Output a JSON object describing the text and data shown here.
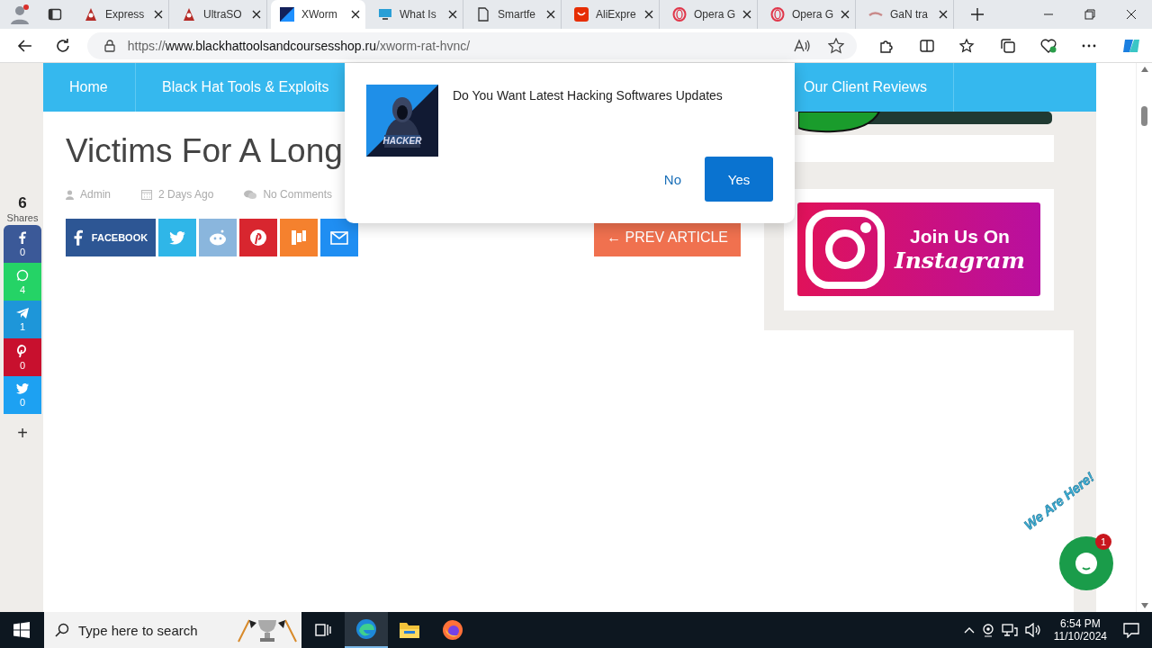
{
  "browser": {
    "tabs": [
      {
        "title": "Express",
        "kind": "hood",
        "selected": false
      },
      {
        "title": "UltraSO",
        "kind": "hood",
        "selected": false
      },
      {
        "title": "XWorm",
        "kind": "dark",
        "selected": true
      },
      {
        "title": "What Is",
        "kind": "monitor",
        "selected": false
      },
      {
        "title": "Smartfe",
        "kind": "page",
        "selected": false
      },
      {
        "title": "AliExpre",
        "kind": "ali",
        "selected": false
      },
      {
        "title": "Opera G",
        "kind": "opera",
        "selected": false
      },
      {
        "title": "Opera G",
        "kind": "opera",
        "selected": false
      },
      {
        "title": "GaN tra",
        "kind": "cable",
        "selected": false
      }
    ],
    "address": {
      "scheme": "https://",
      "host": "www.blackhattoolsandcoursesshop.ru",
      "path": "/xworm-rat-hvnc/"
    }
  },
  "nav": {
    "left": [
      "Home",
      "Black Hat Tools & Exploits"
    ],
    "right": [
      "Our Client Reviews"
    ]
  },
  "article": {
    "title": "Victims For A Long",
    "meta": [
      {
        "kind": "author",
        "text": "Admin"
      },
      {
        "kind": "date",
        "text": "2 Days Ago"
      },
      {
        "kind": "comments",
        "text": "No Comments"
      }
    ],
    "share_buttons": [
      {
        "kind": "facebook",
        "label": "FACEBOOK"
      },
      {
        "kind": "twitter"
      },
      {
        "kind": "reddit"
      },
      {
        "kind": "pinterest"
      },
      {
        "kind": "mix"
      },
      {
        "kind": "email"
      }
    ],
    "prev_article": "← PREV ARTICLE"
  },
  "share_bar": {
    "total": "6",
    "label": "Shares",
    "items": [
      {
        "kind": "facebook",
        "count": "0"
      },
      {
        "kind": "whatsapp",
        "count": "4"
      },
      {
        "kind": "telegram",
        "count": "1"
      },
      {
        "kind": "pinterest",
        "count": "0"
      },
      {
        "kind": "twitter",
        "count": "0"
      }
    ],
    "more": "+"
  },
  "sidebar": {
    "instagram_banner": {
      "line1": "Join Us On",
      "line2": "Instagram"
    }
  },
  "popup": {
    "message": "Do You Want Latest Hacking Softwares Updates",
    "image_label": "HACKER",
    "no": "No",
    "yes": "Yes"
  },
  "chat_widget": {
    "caption": "We Are Here!",
    "badge": "1"
  },
  "taskbar": {
    "search_placeholder": "Type here to search",
    "apps": [
      {
        "kind": "taskview",
        "selected": false
      },
      {
        "kind": "edge",
        "selected": true
      },
      {
        "kind": "explorer",
        "selected": false
      },
      {
        "kind": "firefox",
        "selected": false
      }
    ],
    "time": "6:54 PM",
    "date": "11/10/2024"
  }
}
